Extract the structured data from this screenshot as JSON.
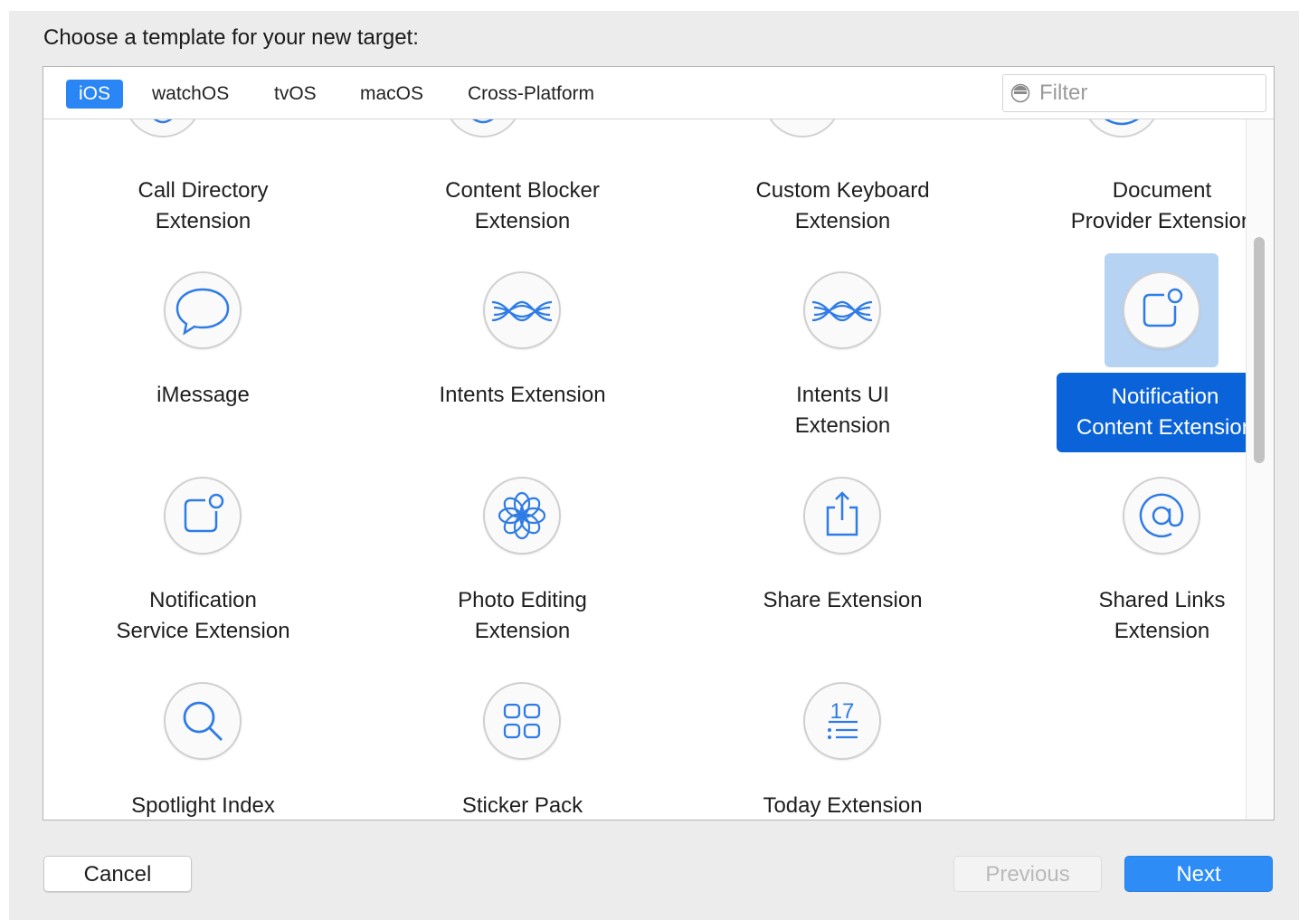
{
  "dialog": {
    "prompt": "Choose a template for your new target:"
  },
  "tabs": [
    {
      "label": "iOS"
    },
    {
      "label": "watchOS"
    },
    {
      "label": "tvOS"
    },
    {
      "label": "macOS"
    },
    {
      "label": "Cross-Platform"
    }
  ],
  "filter": {
    "placeholder": "Filter",
    "icon": "filter-icon"
  },
  "templates": [
    {
      "label": "Call Directory\nExtension"
    },
    {
      "label": "Content Blocker\nExtension"
    },
    {
      "label": "Custom Keyboard\nExtension"
    },
    {
      "label": "Document\nProvider Extension"
    },
    {
      "label": "iMessage",
      "icon": "speech-bubble-icon"
    },
    {
      "label": "Intents Extension",
      "icon": "intents-waves-icon"
    },
    {
      "label": "Intents UI\nExtension",
      "icon": "intents-waves-icon"
    },
    {
      "label": "Notification\nContent Extension",
      "icon": "notification-icon",
      "selected": true
    },
    {
      "label": "Notification\nService Extension",
      "icon": "notification-icon"
    },
    {
      "label": "Photo Editing\nExtension",
      "icon": "flower-icon"
    },
    {
      "label": "Share Extension",
      "icon": "share-icon"
    },
    {
      "label": "Shared Links\nExtension",
      "icon": "at-sign-icon"
    },
    {
      "label": "Spotlight Index",
      "icon": "magnifier-icon"
    },
    {
      "label": "Sticker Pack",
      "icon": "sticker-grid-icon"
    },
    {
      "label": "Today Extension",
      "icon": "today-calendar-icon",
      "icon_text": "17"
    }
  ],
  "buttons": {
    "cancel": "Cancel",
    "previous": "Previous",
    "next": "Next"
  },
  "colors": {
    "accent": "#2a86f5",
    "selection": "#0a63d8",
    "selection_bg": "#b7d3f3",
    "icon_stroke": "#2f7ce6"
  }
}
